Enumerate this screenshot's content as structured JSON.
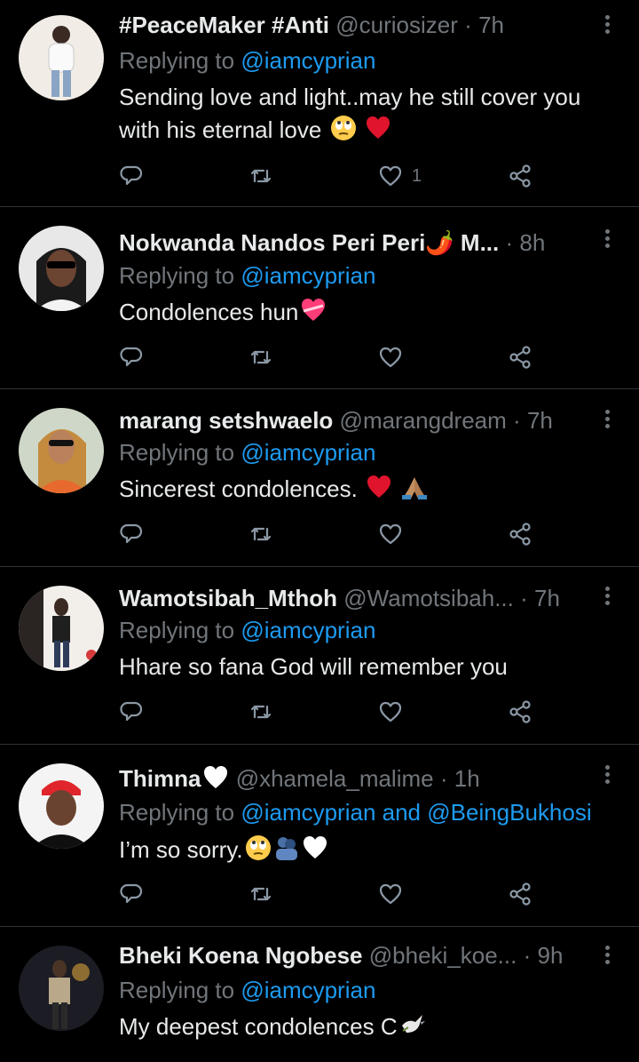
{
  "tweets": [
    {
      "name": "#PeaceMaker #Anti",
      "handle": "@curiosizer",
      "dot": "·",
      "time": "7h",
      "replying_prefix": "Replying to",
      "mentions": "@iamcyprian",
      "text": "Sending love and light..may he still cover you with his eternal love",
      "like_count": "1",
      "emoji": [
        "rolling-eyes",
        "red-heart"
      ]
    },
    {
      "name": "Nokwanda Nandos Peri Peri🌶️ M...",
      "handle": "",
      "dot": "·",
      "time": "8h",
      "replying_prefix": "Replying to",
      "mentions": "@iamcyprian",
      "text": "Condolences hun",
      "like_count": "",
      "emoji": [
        "heart-with-ribbon"
      ]
    },
    {
      "name": "marang setshwaelo",
      "handle": "@marangdream",
      "dot": "·",
      "time": "7h",
      "replying_prefix": "Replying to",
      "mentions": "@iamcyprian",
      "text": "Sincerest condolences.",
      "like_count": "",
      "emoji": [
        "red-heart",
        "folded-hands"
      ]
    },
    {
      "name": "Wamotsibah_Mthoh",
      "handle": "@Wamotsibah...",
      "dot": "·",
      "time": "7h",
      "replying_prefix": "Replying to",
      "mentions": "@iamcyprian",
      "text": "Hhare so fana God will remember you",
      "like_count": "",
      "emoji": []
    },
    {
      "name": "Thimna",
      "handle": "@xhamela_malime",
      "dot": "·",
      "time": "1h",
      "replying_prefix": "Replying to",
      "mentions": "@iamcyprian and @BeingBukhosi",
      "text": "I’m so sorry.",
      "like_count": "",
      "emoji": [
        "rolling-eyes",
        "people-hugging",
        "white-heart"
      ]
    },
    {
      "name": "Bheki Koena Ngobese",
      "handle": "@bheki_koe...",
      "dot": "·",
      "time": "9h",
      "replying_prefix": "Replying to",
      "mentions": "@iamcyprian",
      "text": "My deepest condolences C",
      "like_count": "",
      "emoji": [
        "dove"
      ]
    }
  ],
  "colors": {
    "background": "#000000",
    "text": "#e7e9ea",
    "muted": "#71767b",
    "link": "#1d9bf0",
    "divider": "#2f3336"
  },
  "icons": {
    "reply": "reply-icon",
    "retweet": "retweet-icon",
    "like": "like-icon",
    "share": "share-icon",
    "more": "more-icon"
  }
}
